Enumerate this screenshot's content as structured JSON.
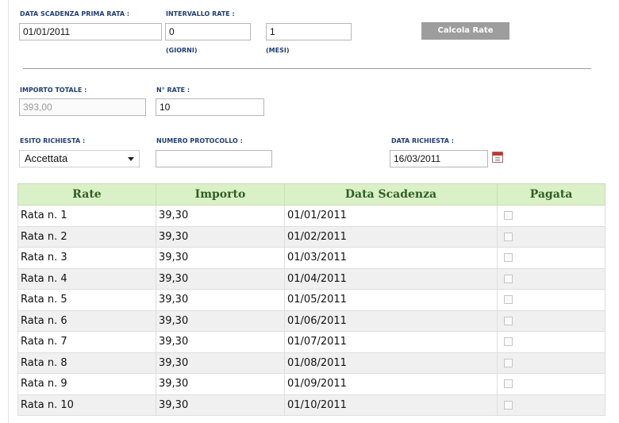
{
  "form": {
    "first_due_label": "DATA SCADENZA PRIMA RATA :",
    "first_due_value": "01/01/2011",
    "interval_label": "INTERVALLO RATE :",
    "interval_days_value": "0",
    "interval_days_unit": "(GIORNI)",
    "interval_months_value": "1",
    "interval_months_unit": "(MESI)",
    "calc_button": "Calcola Rate",
    "total_label": "IMPORTO TOTALE :",
    "total_value": "393,00",
    "num_rates_label": "N° RATE :",
    "num_rates_value": "10",
    "outcome_label": "ESITO RICHIESTA :",
    "outcome_value": "Accettata",
    "protocol_label": "NUMERO PROTOCOLLO :",
    "protocol_value": "",
    "request_date_label": "DATA RICHIESTA :",
    "request_date_value": "16/03/2011"
  },
  "table": {
    "headers": [
      "Rate",
      "Importo",
      "Data Scadenza",
      "Pagata"
    ],
    "rows": [
      {
        "rate": "Rata n. 1",
        "amount": "39,30",
        "due": "01/01/2011",
        "paid": false
      },
      {
        "rate": "Rata n. 2",
        "amount": "39,30",
        "due": "01/02/2011",
        "paid": false
      },
      {
        "rate": "Rata n. 3",
        "amount": "39,30",
        "due": "01/03/2011",
        "paid": false
      },
      {
        "rate": "Rata n. 4",
        "amount": "39,30",
        "due": "01/04/2011",
        "paid": false
      },
      {
        "rate": "Rata n. 5",
        "amount": "39,30",
        "due": "01/05/2011",
        "paid": false
      },
      {
        "rate": "Rata n. 6",
        "amount": "39,30",
        "due": "01/06/2011",
        "paid": false
      },
      {
        "rate": "Rata n. 7",
        "amount": "39,30",
        "due": "01/07/2011",
        "paid": false
      },
      {
        "rate": "Rata n. 8",
        "amount": "39,30",
        "due": "01/08/2011",
        "paid": false
      },
      {
        "rate": "Rata n. 9",
        "amount": "39,30",
        "due": "01/09/2011",
        "paid": false
      },
      {
        "rate": "Rata n. 10",
        "amount": "39,30",
        "due": "01/10/2011",
        "paid": false
      }
    ]
  },
  "icons": {
    "calendar": "calendar-icon",
    "dropdown": "chevron-down-icon"
  },
  "colors": {
    "label": "#1f3e72",
    "header_bg": "#daf0c6",
    "header_text": "#2f5e22",
    "button_bg": "#9d9d9d"
  }
}
